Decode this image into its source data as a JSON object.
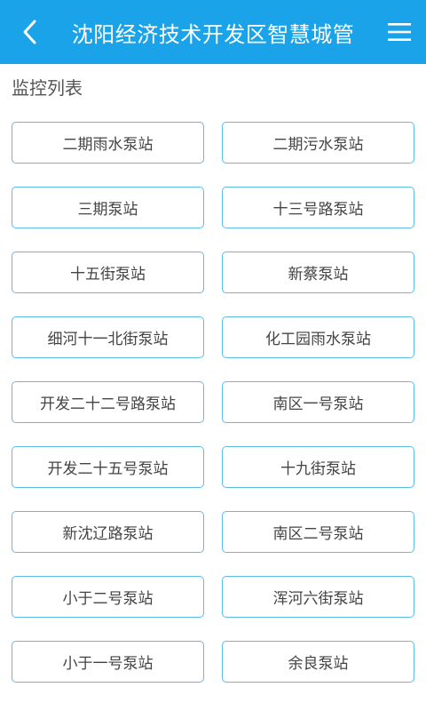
{
  "header": {
    "title": "沈阳经济技术开发区智慧城管",
    "back_icon": "chevron-left-icon",
    "menu_icon": "hamburger-menu-icon",
    "background_color": "#1aa3e8"
  },
  "section": {
    "title": "监控列表"
  },
  "stations": [
    {
      "label": "二期雨水泵站"
    },
    {
      "label": "二期污水泵站"
    },
    {
      "label": "三期泵站"
    },
    {
      "label": "十三号路泵站"
    },
    {
      "label": "十五街泵站"
    },
    {
      "label": "新蔡泵站"
    },
    {
      "label": "细河十一北街泵站"
    },
    {
      "label": "化工园雨水泵站"
    },
    {
      "label": "开发二十二号路泵站"
    },
    {
      "label": "南区一号泵站"
    },
    {
      "label": "开发二十五号泵站"
    },
    {
      "label": "十九街泵站"
    },
    {
      "label": "新沈辽路泵站"
    },
    {
      "label": "南区二号泵站"
    },
    {
      "label": "小于二号泵站"
    },
    {
      "label": "浑河六街泵站"
    },
    {
      "label": "小于一号泵站"
    },
    {
      "label": "余良泵站"
    }
  ],
  "colors": {
    "accent": "#1aa3e8",
    "button_border": "#5bbde8",
    "button_text": "#444444"
  }
}
